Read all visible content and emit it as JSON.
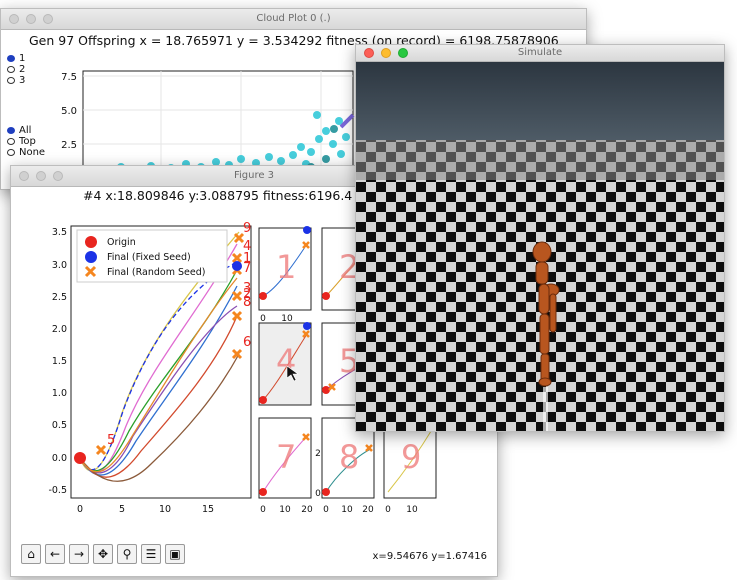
{
  "cloud": {
    "title": "Cloud Plot 0 (.)",
    "header": "Gen 97 Offspring x = 18.765971  y = 3.534292 fitness (on record) = 6198.75878906",
    "radio_groups": [
      {
        "items": [
          {
            "label": "1",
            "selected": true
          },
          {
            "label": "2",
            "selected": false
          },
          {
            "label": "3",
            "selected": false
          }
        ]
      },
      {
        "items": [
          {
            "label": "All",
            "selected": true
          },
          {
            "label": "Top",
            "selected": false
          },
          {
            "label": "None",
            "selected": false
          }
        ]
      }
    ],
    "yticks": [
      "7.5",
      "5.0",
      "2.5"
    ]
  },
  "figure": {
    "title": "Figure 3",
    "header": "#4  x:18.809846  y:3.088795  fitness:6196.4",
    "legend": {
      "origin": "Origin",
      "fixed": "Final (Fixed Seed)",
      "random": "Final (Random Seed)"
    },
    "colors": {
      "origin": "#e8251f",
      "fixed": "#1b32e6",
      "random": "#f5861f",
      "digit": "#ef7f7f"
    },
    "yticks": [
      "3.5",
      "3.0",
      "2.5",
      "2.0",
      "1.5",
      "1.0",
      "0.5",
      "0.0",
      "-0.5"
    ],
    "xticks": [
      "0",
      "5",
      "10",
      "15"
    ],
    "traj_labels": [
      "9",
      "4",
      "1",
      "7",
      "3",
      "8",
      "2",
      "6",
      "5"
    ],
    "small_digits": [
      "1",
      "2",
      "4",
      "5",
      "7",
      "8",
      "9"
    ],
    "small_xticks_a": [
      "0",
      "10"
    ],
    "small_xticks_b": [
      "0",
      "10",
      "20"
    ],
    "small_xticks_c": [
      "0",
      "10",
      "20"
    ],
    "small_xticks_d": [
      "0",
      "10"
    ],
    "small_yticks": [
      "2",
      "0"
    ],
    "coords": "x=9.54676    y=1.67416",
    "toolbar": [
      {
        "name": "home-icon",
        "glyph": "⌂"
      },
      {
        "name": "back-icon",
        "glyph": "←"
      },
      {
        "name": "forward-icon",
        "glyph": "→"
      },
      {
        "name": "pan-icon",
        "glyph": "✥"
      },
      {
        "name": "zoom-icon",
        "glyph": "⚲"
      },
      {
        "name": "subplots-icon",
        "glyph": "☰"
      },
      {
        "name": "save-icon",
        "glyph": "▣"
      }
    ]
  },
  "simulate": {
    "title": "Simulate"
  }
}
